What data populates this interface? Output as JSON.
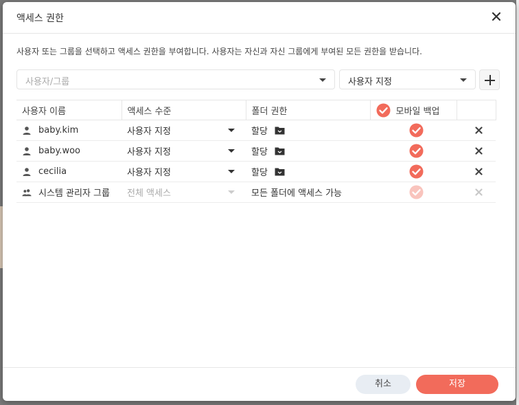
{
  "dialog": {
    "title": "액세스 권한",
    "description": "사용자 또는 그룹을 선택하고 액세스 권한을 부여합니다. 사용자는 자신과 자신 그룹에게 부여된 모든 권한을 받습니다."
  },
  "picker": {
    "user_placeholder": "사용자/그룹",
    "access_value": "사용자 지정"
  },
  "table": {
    "headers": {
      "user": "사용자 이름",
      "access": "액세스 수준",
      "folder": "폴더 권한",
      "mobile": "모바일 백업"
    },
    "rows": [
      {
        "user": "baby.kim",
        "type": "user",
        "access": "사용자 지정",
        "folder": "할당",
        "mobile": true
      },
      {
        "user": "baby.woo",
        "type": "user",
        "access": "사용자 지정",
        "folder": "할당",
        "mobile": true
      },
      {
        "user": "cecilia",
        "type": "user",
        "access": "사용자 지정",
        "folder": "할당",
        "mobile": true
      },
      {
        "user": "시스템 관리자 그룹",
        "type": "group",
        "access": "전체 액세스",
        "folder": "모든 폴더에 액세스 가능",
        "mobile": true,
        "disabled": true
      }
    ]
  },
  "footer": {
    "cancel": "취소",
    "save": "저장"
  },
  "colors": {
    "accent": "#f26b5b",
    "cancel_bg": "#e8edf3"
  },
  "icons": [
    "close-icon",
    "add-icon",
    "user-icon",
    "group-icon",
    "folder-icon",
    "check-icon",
    "remove-icon",
    "dropdown-caret-icon"
  ]
}
